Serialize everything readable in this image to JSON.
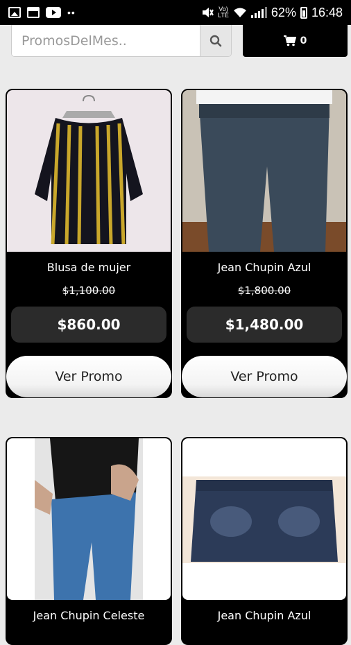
{
  "status_bar": {
    "network_label": "Vo)\nLTE",
    "battery": "62%",
    "time": "16:48",
    "notification_icons": [
      "image-icon",
      "calendar-icon",
      "youtube-icon",
      "more-dots-icon"
    ],
    "system_icons": [
      "mute-icon",
      "wifi-icon",
      "signal-icon",
      "battery-icon"
    ]
  },
  "search": {
    "placeholder": "PromosDelMes..",
    "icon": "search-icon"
  },
  "cart": {
    "icon": "cart-icon",
    "count": "0"
  },
  "products": [
    {
      "name": "Blusa de mujer",
      "old_price": "$1,100.00",
      "price": "$860.00",
      "button": "Ver Promo"
    },
    {
      "name": "Jean Chupin Azul",
      "old_price": "$1,800.00",
      "price": "$1,480.00",
      "button": "Ver Promo"
    },
    {
      "name": "Jean Chupin Celeste"
    },
    {
      "name": "Jean Chupin Azul"
    }
  ],
  "colors": {
    "accent": "#000000",
    "page_bg": "#ebebeb",
    "price_bg": "#2b2b2b"
  }
}
